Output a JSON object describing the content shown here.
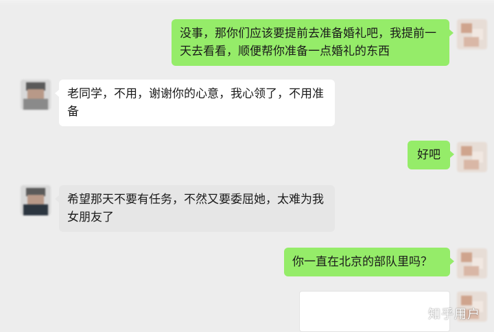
{
  "messages": [
    {
      "side": "right",
      "text": "没事，那你们应该要提前去准备婚礼吧，我提前一天去看看，顺便帮你准备一点婚礼的东西"
    },
    {
      "side": "left",
      "text": "老同学，不用，谢谢你的心意，我心领了，不用准备"
    },
    {
      "side": "right",
      "text": "好吧"
    },
    {
      "side": "left",
      "text": "希望那天不要有任务，不然又要委屈她，太难为我女朋友了"
    },
    {
      "side": "right",
      "text": "你一直在北京的部队里吗？"
    },
    {
      "side": "right",
      "text": ""
    }
  ],
  "watermark": "知乎用户",
  "colors": {
    "background": "#ededed",
    "sent_bubble": "#95ec69",
    "received_bubble": "#ffffff",
    "received_bubble_alt": "#e6e6e6"
  }
}
